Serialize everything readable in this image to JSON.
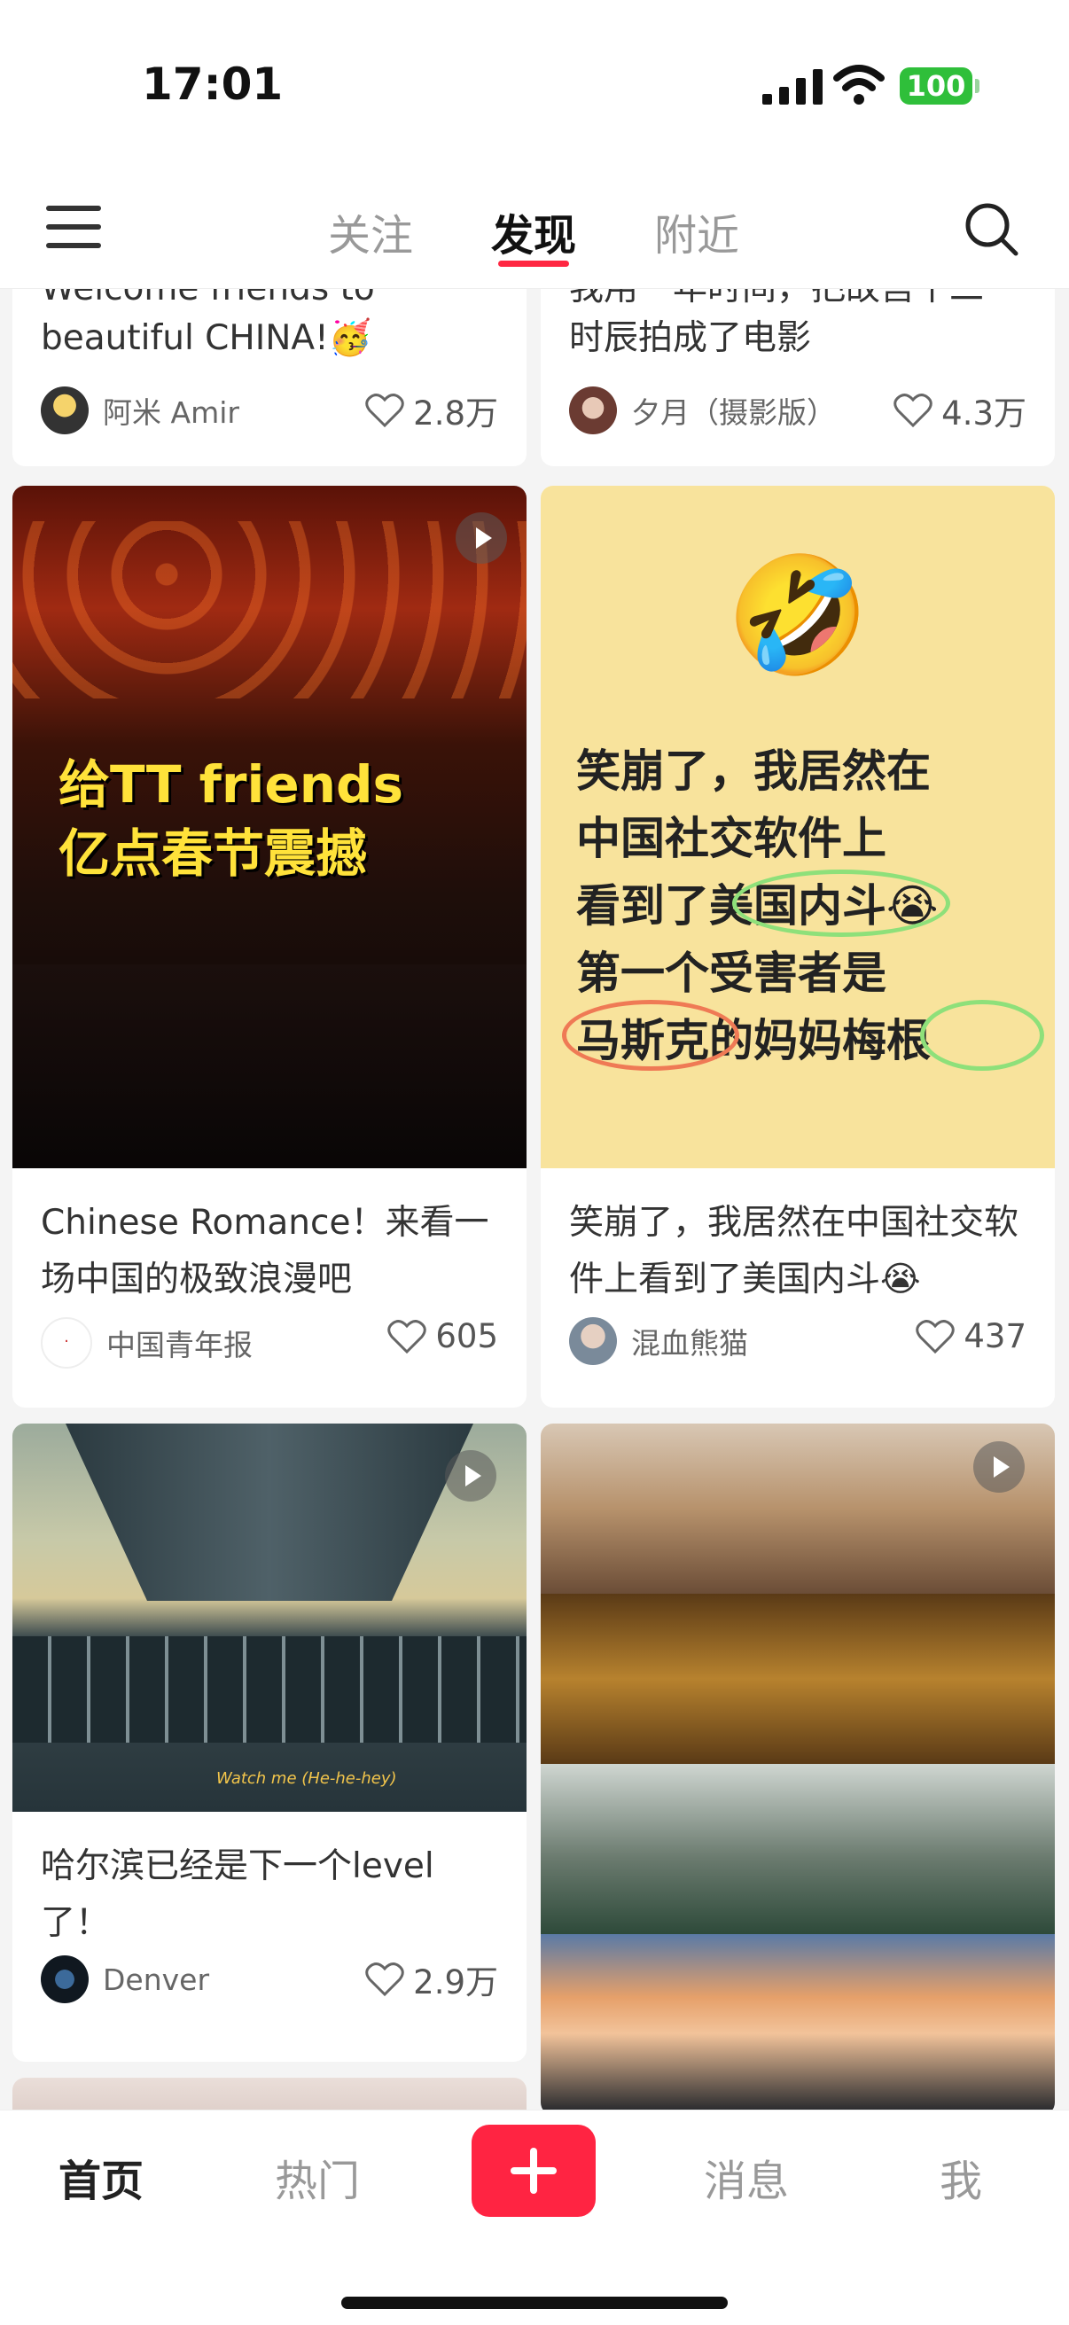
{
  "status_bar": {
    "time": "17:01",
    "battery": "100"
  },
  "header": {
    "tabs": [
      {
        "label": "关注",
        "active": false
      },
      {
        "label": "发现",
        "active": true
      },
      {
        "label": "附近",
        "active": false
      }
    ]
  },
  "feed": {
    "cards": [
      {
        "title_line_partial": "Welcome friends to",
        "title_line": "beautiful CHINA!🥳",
        "author": "阿米 Amir",
        "likes": "2.8万"
      },
      {
        "title_line_partial": "我用一年时间，把故宫十二",
        "title_line": "时辰拍成了电影",
        "author": "夕月（摄影版）",
        "likes": "4.3万"
      },
      {
        "title": "Chinese Romance！来看一场中国的极致浪漫吧",
        "overlay_line1": "给TT friends",
        "overlay_line2": "亿点春节震撼",
        "author": "中国青年报",
        "likes": "605",
        "video": true
      },
      {
        "title": "笑崩了，我居然在中国社交软件上看到了美国内斗😭",
        "cover_emoji": "🤣",
        "cover_lines": [
          "笑崩了，我居然在",
          "中国社交软件上",
          "看到了美国内斗😭",
          "第一个受害者是",
          "马斯克的妈妈梅根"
        ],
        "author": "混血熊猫",
        "likes": "437"
      },
      {
        "title": "哈尔滨已经是下一个level了！",
        "subtitle_caption": "Watch me (He-he-hey)",
        "author": "Denver",
        "likes": "2.9万",
        "video": true
      },
      {
        "video": true
      }
    ]
  },
  "bottom_nav": {
    "items": [
      {
        "label": "首页",
        "active": true
      },
      {
        "label": "热门",
        "active": false
      },
      {
        "label": "消息",
        "active": false
      },
      {
        "label": "我",
        "active": false
      }
    ]
  },
  "colors": {
    "accent": "#ff2442",
    "battery": "#2fbf3a"
  }
}
